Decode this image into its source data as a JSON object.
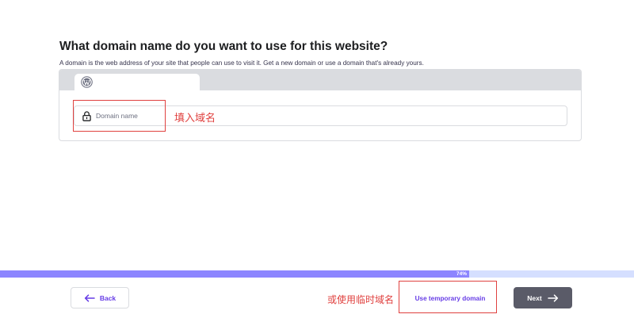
{
  "page": {
    "title": "What domain name do you want to use for this website?",
    "subtitle": "A domain is the web address of your site that people can use to visit it. Get a new domain or use a domain that's already yours."
  },
  "browser": {
    "tab_icon": "wordpress-icon"
  },
  "domain_field": {
    "icon": "lock-icon",
    "placeholder": "Domain name"
  },
  "annotations": {
    "fill_domain": "填入域名",
    "or_temporary": "或使用临时域名"
  },
  "progress": {
    "percent": 74,
    "label": "74%"
  },
  "footer": {
    "back_label": "Back",
    "temp_domain_label": "Use temporary domain",
    "next_label": "Next"
  },
  "colors": {
    "accent": "#673de6",
    "progress_fill": "#8c85ff",
    "progress_track": "#d5dfff",
    "next_button": "#5a5b68",
    "annotation_red": "#e0413f"
  }
}
